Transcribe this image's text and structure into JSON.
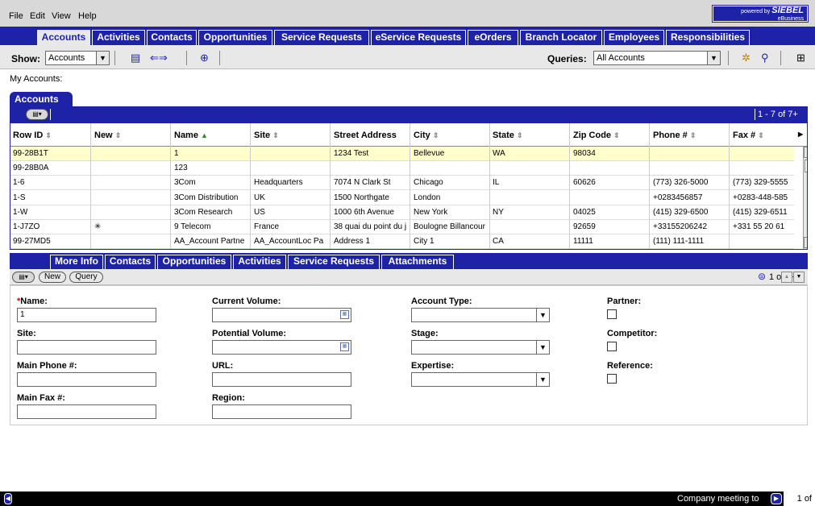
{
  "menu": {
    "items": [
      "File",
      "Edit",
      "View",
      "Help"
    ]
  },
  "brand": {
    "line1": "powered by",
    "name": "SIEBEL",
    "line2": "eBusiness"
  },
  "nav_tabs": [
    "Accounts",
    "Activities",
    "Contacts",
    "Opportunities",
    "Service Requests",
    "eService Requests",
    "eOrders",
    "Branch Locator",
    "Employees",
    "Responsibilities"
  ],
  "toolbar": {
    "show_label": "Show:",
    "show_value": "Accounts",
    "queries_label": "Queries:",
    "queries_value": "All Accounts"
  },
  "page_subtitle": "My Accounts:",
  "list": {
    "title": "Accounts",
    "counter": "1 - 7 of 7+",
    "columns": [
      "Row ID",
      "New",
      "Name",
      "Site",
      "Street Address",
      "City",
      "State",
      "Zip Code",
      "Phone #",
      "Fax #"
    ],
    "rows": [
      [
        "99-28B1T",
        "",
        "1",
        "",
        "1234 Test",
        "Bellevue",
        "WA",
        "98034",
        "",
        ""
      ],
      [
        "99-28B0A",
        "",
        "123",
        "",
        "",
        "",
        "",
        "",
        "",
        ""
      ],
      [
        "1-6",
        "",
        "3Com",
        "Headquarters",
        "7074 N Clark St",
        "Chicago",
        "IL",
        "60626",
        "(773) 326-5000",
        "(773) 329-5555"
      ],
      [
        "1-S",
        "",
        "3Com Distribution",
        "UK",
        "1500 Northgate",
        "London",
        "",
        "",
        "+0283456857",
        "+0283-448-585"
      ],
      [
        "1-W",
        "",
        "3Com Research",
        "US",
        "1000 6th Avenue",
        "New York",
        "NY",
        "04025",
        "(415) 329-6500",
        "(415) 329-6511"
      ],
      [
        "1-J7ZO",
        "✳",
        "9 Telecom",
        "France",
        "38 quai du point du j",
        "Boulogne Billancour",
        "",
        "92659",
        "+33155206242",
        "+331 55 20 61"
      ],
      [
        "99-27MD5",
        "",
        "AA_Account Partne",
        "AA_AccountLoc Pa",
        "Address 1",
        "City 1",
        "CA",
        "11111",
        "(111) 111-1111",
        ""
      ]
    ]
  },
  "detail_tabs": [
    "More Info",
    "Contacts",
    "Opportunities",
    "Activities",
    "Service Requests",
    "Attachments"
  ],
  "form_bar": {
    "new_label": "New",
    "query_label": "Query",
    "counter": "1 of 7+"
  },
  "form": {
    "name_label": "Name:",
    "name_value": "1",
    "site_label": "Site:",
    "main_phone_label": "Main Phone #:",
    "main_fax_label": "Main Fax #:",
    "current_volume_label": "Current Volume:",
    "potential_volume_label": "Potential Volume:",
    "url_label": "URL:",
    "region_label": "Region:",
    "account_type_label": "Account Type:",
    "stage_label": "Stage:",
    "expertise_label": "Expertise:",
    "partner_label": "Partner:",
    "competitor_label": "Competitor:",
    "reference_label": "Reference:"
  },
  "status": {
    "message": "Company meeting to",
    "page": "1 of"
  },
  "colors": {
    "brand_blue": "#1e22a6",
    "selected_row": "#ffffcc",
    "panel_gray": "#e8e8e8"
  }
}
